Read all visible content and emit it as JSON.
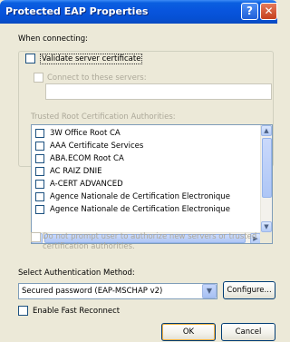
{
  "window": {
    "title": "Protected EAP Properties",
    "help_glyph": "?",
    "close_glyph": "✕"
  },
  "section_label": "When connecting:",
  "validate_cert": {
    "label": "Validate server certificate",
    "checked": false
  },
  "connect_servers": {
    "label": "Connect to these servers:",
    "value": "",
    "enabled": false
  },
  "trusted_roots": {
    "label": "Trusted Root Certification Authorities:",
    "items": [
      {
        "label": "3W Office Root CA",
        "checked": false
      },
      {
        "label": "AAA Certificate Services",
        "checked": false
      },
      {
        "label": "ABA.ECOM Root CA",
        "checked": false
      },
      {
        "label": "AC RAIZ DNIE",
        "checked": false
      },
      {
        "label": "A-CERT ADVANCED",
        "checked": false
      },
      {
        "label": "Agence Nationale de Certification Electronique",
        "checked": false
      },
      {
        "label": "Agence Nationale de Certification Electronique",
        "checked": false
      }
    ]
  },
  "no_prompt": {
    "line1": "Do not prompt user to authorize new servers or trusted",
    "line2": "certification authorities.",
    "enabled": false
  },
  "auth_method": {
    "label": "Select Authentication Method:",
    "selected": "Secured password (EAP-MSCHAP v2)",
    "configure_label": "Configure..."
  },
  "fast_reconnect": {
    "label": "Enable Fast Reconnect",
    "checked": false
  },
  "footer": {
    "ok_label": "OK",
    "cancel_label": "Cancel"
  }
}
